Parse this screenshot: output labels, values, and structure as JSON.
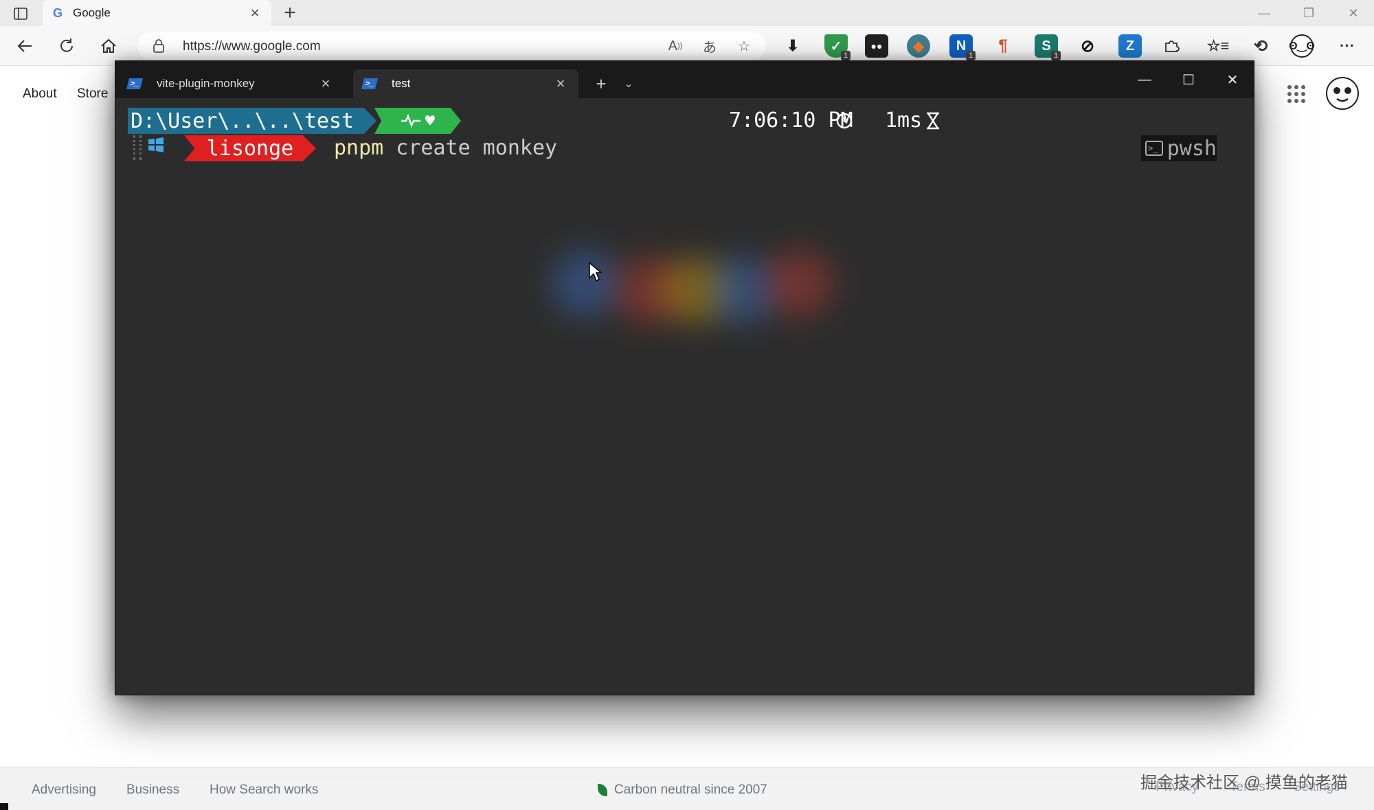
{
  "browser": {
    "tab": {
      "title": "Google"
    },
    "address": {
      "url": "https://www.google.com"
    },
    "icons": [
      "sidebar-toggle-icon",
      "back-icon",
      "refresh-icon",
      "home-icon",
      "lock-icon",
      "read-aloud-icon",
      "translate-icon",
      "add-favorite-icon",
      "download-icon",
      "favorites-icon",
      "history-icon",
      "more-icon"
    ],
    "extension_badges": {
      "shield": "1",
      "n": "1",
      "s": "1"
    }
  },
  "page": {
    "nav": {
      "about": "About",
      "store": "Store"
    },
    "footer": {
      "advertising": "Advertising",
      "business": "Business",
      "how_search": "How Search works",
      "carbon": "Carbon neutral since 2007",
      "privacy": "Privacy",
      "terms": "Terms",
      "settings": "Settings"
    },
    "watermark": "掘金技术社区 @ 摸鱼的老猫"
  },
  "terminal": {
    "tabs": [
      {
        "title": "vite-plugin-monkey"
      },
      {
        "title": "test"
      }
    ],
    "prompt": {
      "path": "D:\\User\\..\\..\\test",
      "user": "lisonge",
      "command_bin": "pnpm",
      "command_args": " create monkey",
      "time": "7:06:10 PM",
      "duration": "1ms",
      "shell": "pwsh"
    },
    "colors": {
      "path": "#1e6e8f",
      "status": "#2db44a",
      "user": "#e02020",
      "background": "#2c2c2c"
    }
  }
}
